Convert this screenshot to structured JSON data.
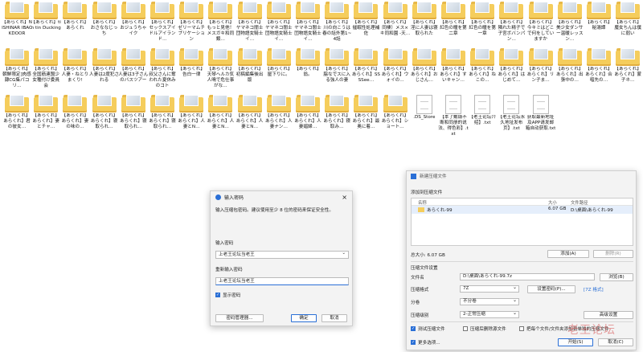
{
  "desktop": {
    "files": [
      {
        "name": "【あらくれ】NISHINAR IBACKDOOR",
        "kind": "folder"
      },
      {
        "name": "【あらくれ】tin tin Ducking",
        "kind": "folder"
      },
      {
        "name": "【あらくれ】あらくれ",
        "kind": "folder"
      },
      {
        "name": "【あらくれ】おさななじっち",
        "kind": "folder"
      },
      {
        "name": "【あらくれ】おジュうちゃイク",
        "kind": "folder"
      },
      {
        "name": "【あらくれ】セックスアイドルアイランド…",
        "kind": "folder"
      },
      {
        "name": "【あらくれ】ゼリーマムチブリケーション",
        "kind": "folder"
      },
      {
        "name": "【あらくれ】もっと見他！メスガキ和同類…",
        "kind": "folder"
      },
      {
        "name": "【あらくれ】ヤマネコ闇士団物語女騎士イ…",
        "kind": "folder"
      },
      {
        "name": "【あらくれ】ヤマネコ闇士団物語女騎士イ…",
        "kind": "folder"
      },
      {
        "name": "【あらくれ】ヤマネコ闇士団物語女騎士イ…",
        "kind": "folder"
      },
      {
        "name": "【あらくれ】川の向こうは春の話外第1~4話",
        "kind": "folder"
      },
      {
        "name": "【あらくれ】催眠性処理補佐",
        "kind": "folder"
      },
      {
        "name": "【あらくれ】同棲）メス×キ同和園 -天…",
        "kind": "folder"
      },
      {
        "name": "【あらくれ】淫に人妻は寝取られた",
        "kind": "folder"
      },
      {
        "name": "【あらくれ】紅色の瞳を第二章",
        "kind": "folder"
      },
      {
        "name": "【あらくれ】紅色の瞳を第一章",
        "kind": "folder"
      },
      {
        "name": "【あらくれ】隣れた精子で子宮ボバンパン…",
        "kind": "folder"
      },
      {
        "name": "【あらくれ】今キミはどこで何をしていますか",
        "kind": "folder"
      },
      {
        "name": "【あらくれ】美少女ダンサー温暖レッスン…",
        "kind": "folder"
      },
      {
        "name": "【あらくれ】秘湯譚",
        "kind": "folder"
      },
      {
        "name": "【あらくれ】魔女ちんは僕に弱い",
        "kind": "folder"
      },
      {
        "name": "【あらくれ】朝鮮限定]肉感隷CG集パコリ…",
        "kind": "folder"
      },
      {
        "name": "【あらくれ】全国筋連盟少女種付け委員会",
        "kind": "folder"
      },
      {
        "name": "【あらくれ】人妻・ねとりまくり!",
        "kind": "folder"
      },
      {
        "name": "【あらくれ】人妻は2度犯される",
        "kind": "folder"
      },
      {
        "name": "【あらくれ】人妻は3子さんのバスツアー",
        "kind": "folder"
      },
      {
        "name": "【あらくれ】叔父さんに奪われた夏休みのコト",
        "kind": "folder"
      },
      {
        "name": "【あらくれ】告白一律",
        "kind": "folder"
      },
      {
        "name": "【あらくれ】天琴へルカ気人鳴で危仕事がな…",
        "kind": "folder"
      },
      {
        "name": "【あらくれ】初稿編集後出版",
        "kind": "folder"
      },
      {
        "name": "【あらくれ】屋下りに。",
        "kind": "folder"
      },
      {
        "name": "【あらくれ】翁。",
        "kind": "folder"
      },
      {
        "name": "【あらくれ】脇なでスに入る強人の妻",
        "kind": "folder"
      },
      {
        "name": "【あらくれ】あらくれ】SSSSee…",
        "kind": "folder"
      },
      {
        "name": "【あらくれ】あらくれ】ウォイの…",
        "kind": "folder"
      },
      {
        "name": "【あらくれ】あらくれ】おじさん…",
        "kind": "folder"
      },
      {
        "name": "【あらくれ】あらくれ】すいキャン…",
        "kind": "folder"
      },
      {
        "name": "【あらくれ】あらくれ】ねこの…",
        "kind": "folder"
      },
      {
        "name": "【あらくれ】あらくれ】はじめて…",
        "kind": "folder"
      },
      {
        "name": "【あらくれ】あらくれ】リン子ま…",
        "kind": "folder"
      },
      {
        "name": "【あらくれ】あらくれ】出張中の…",
        "kind": "folder"
      },
      {
        "name": "【あらくれ】あらくれ】合唱先の…",
        "kind": "folder"
      },
      {
        "name": "【あらくれ】あらくれ】蒙子ネ…",
        "kind": "folder"
      },
      {
        "name": "【あらくれ】あらくれ】君の彼女…",
        "kind": "folder"
      },
      {
        "name": "【あらくれ】あらくれ】妻とチャ…",
        "kind": "folder"
      },
      {
        "name": "【あらくれ】あらくれ】妻の味の…",
        "kind": "folder"
      },
      {
        "name": "【あらくれ】あらくれ】寝取られ…",
        "kind": "folder"
      },
      {
        "name": "【あらくれ】あらくれ】寝取られ…",
        "kind": "folder"
      },
      {
        "name": "【あらくれ】あらくれ】寝取られ…",
        "kind": "folder"
      },
      {
        "name": "【あらくれ】あらくれ】人妻とN…",
        "kind": "folder"
      },
      {
        "name": "【あらくれ】あらくれ】人妻とN…",
        "kind": "folder"
      },
      {
        "name": "【あらくれ】あらくれ】人妻とN…",
        "kind": "folder"
      },
      {
        "name": "【あらくれ】あらくれ】人妻ナン…",
        "kind": "folder"
      },
      {
        "name": "【あらくれ】あらくれ】人妻娼婦…",
        "kind": "folder"
      },
      {
        "name": "【あらくれ】あらくれ】寝取み…",
        "kind": "folder"
      },
      {
        "name": "【あらくれ】あらくれ】最奥に着…",
        "kind": "folder"
      },
      {
        "name": "【あらくれ】あらくれ】ショート…",
        "kind": "folder"
      },
      {
        "name": ".DS_Store",
        "kind": "file"
      },
      {
        "name": "【本了戴锻不断和同册的说法、得色彩】.txt",
        "kind": "file"
      },
      {
        "name": "【老王论坛介绍】.txt",
        "kind": "file"
      },
      {
        "name": "【老王论坛永久地址发布页】.txt",
        "kind": "file"
      },
      {
        "name": "获取最新地址及APP请发邮箱自动获取.txt",
        "kind": "file"
      }
    ]
  },
  "password_dialog": {
    "title": "输入密码",
    "description": "输入压缩包密码。建议使用至少 8 位的密码来保证安全性。",
    "enter_label": "输入密码",
    "enter_value": "上老王论坛当老王",
    "reenter_label": "重新输入密码",
    "reenter_value": "上老王论坛当老王",
    "show_password": "显示密码",
    "manage_button": "密码管理器...",
    "ok_button": "确定",
    "cancel_button": "取消"
  },
  "archive_dialog": {
    "title": "新建压缩文件",
    "add_section": "添加到压缩文件",
    "col_name": "名称",
    "col_size": "大小",
    "col_path": "文件路径",
    "item_name": "あらくれ-99",
    "item_size": "6.07 GB",
    "item_path": "D:\\桌面\\あらくれ-99",
    "total": "总大小: 6.07 GB",
    "add_button": "添加(A)",
    "remove_button": "删除(R)",
    "settings_section": "压缩文件设置",
    "filename_label": "文件名",
    "filename_value": "D:\\桌面\\あらくれ-99.7z",
    "browse_button": "浏览(B)",
    "format_label": "压缩格式",
    "format_value": "7Z",
    "set_password_button": "设置密码(P)...",
    "format_link": "[7Z 格式]",
    "split_label": "分卷",
    "split_value": "不分卷",
    "level_label": "压缩级别",
    "level_value": "2-正常压缩",
    "advanced_button": "高级设置",
    "test_check": "测试压缩文件",
    "delete_check": "压缩后删除源文件",
    "separate_check": "把每个文件/文件夹添加到单独的压缩文件",
    "more_options": "更多选项...",
    "start_button": "开始(S)",
    "cancel_button": "取消(C)"
  },
  "watermark": "老王论坛"
}
